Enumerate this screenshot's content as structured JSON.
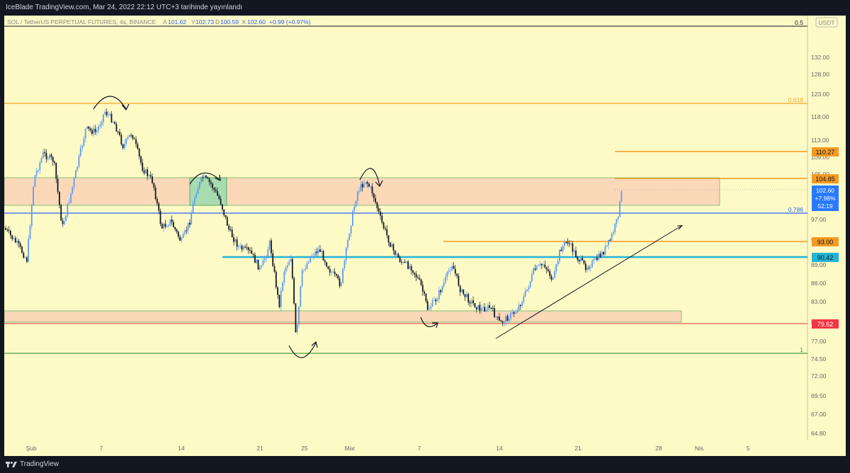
{
  "header": {
    "published_text": "IceBlade TradingView.com, Mar 24, 2022 22:12 UTC+3 tarihinde yayınlandı"
  },
  "legend": {
    "symbol": "SOL / TetherUS PERPETUAL FUTURES, 4s, BINANCE",
    "o_label": "A",
    "o_value": "101.62",
    "h_label": "Y",
    "h_value": "102.73",
    "l_label": "D",
    "l_value": "100.59",
    "c_label": "K",
    "c_value": "102.60",
    "change": "+0.99 (+0.97%)"
  },
  "price_axis": {
    "currency": "USDT",
    "ticks": [
      "132.00",
      "128.00",
      "123.00",
      "118.00",
      "113.00",
      "109.00",
      "105.00",
      "101.00",
      "97.00",
      "93.00",
      "89.00",
      "86.00",
      "83.00",
      "80.00",
      "77.00",
      "74.50",
      "72.00",
      "69.50",
      "67.00",
      "64.80"
    ]
  },
  "time_axis": {
    "ticks": [
      "Şub",
      "7",
      "14",
      "21",
      "25",
      "Mar",
      "7",
      "14",
      "21",
      "28",
      "Nis",
      "5"
    ]
  },
  "levels": {
    "fib_05": "0.5",
    "fib_0618": "0.618",
    "fib_0786": "0.786",
    "fib_1": "1",
    "res_110": "110.27",
    "res_104": "104.85",
    "lvl_93": "93.00",
    "lvl_9042": "90.42",
    "lvl_7962": "79.62"
  },
  "last_price": {
    "price": "102.60",
    "change": "+7.98%",
    "countdown": "52:19"
  },
  "colors": {
    "chart_bg": "#fefac6",
    "up_candle": "#5b9cf6",
    "down_candle": "#131722",
    "orange": "#f5a623",
    "blue": "#2962ff",
    "cyan": "#22b4d6",
    "red": "#f23645",
    "green": "#43a047"
  },
  "footer": {
    "brand": "TradingView"
  }
}
